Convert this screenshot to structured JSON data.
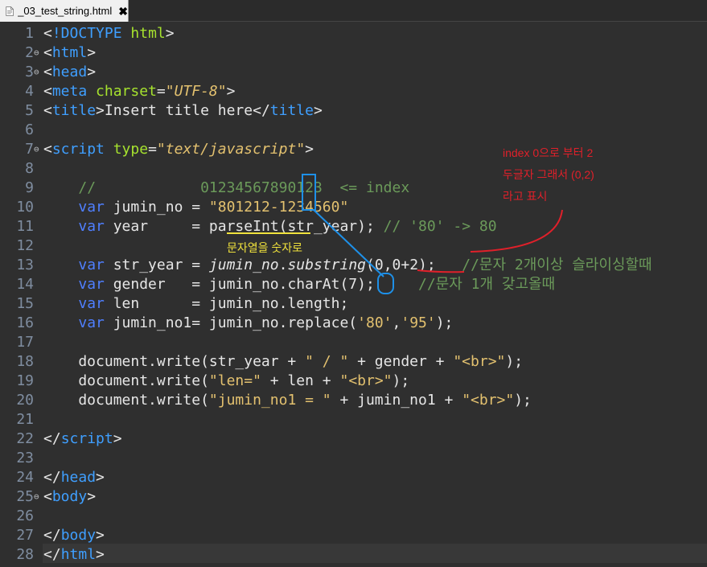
{
  "tab": {
    "title": "_03_test_string.html",
    "close": "✖"
  },
  "editor": {
    "lines": [
      {
        "n": "1",
        "fold": ""
      },
      {
        "n": "2",
        "fold": "⊖"
      },
      {
        "n": "3",
        "fold": "⊖"
      },
      {
        "n": "4",
        "fold": ""
      },
      {
        "n": "5",
        "fold": ""
      },
      {
        "n": "6",
        "fold": ""
      },
      {
        "n": "7",
        "fold": "⊖"
      },
      {
        "n": "8",
        "fold": ""
      },
      {
        "n": "9",
        "fold": ""
      },
      {
        "n": "10",
        "fold": ""
      },
      {
        "n": "11",
        "fold": ""
      },
      {
        "n": "12",
        "fold": ""
      },
      {
        "n": "13",
        "fold": ""
      },
      {
        "n": "14",
        "fold": ""
      },
      {
        "n": "15",
        "fold": ""
      },
      {
        "n": "16",
        "fold": ""
      },
      {
        "n": "17",
        "fold": ""
      },
      {
        "n": "18",
        "fold": ""
      },
      {
        "n": "19",
        "fold": ""
      },
      {
        "n": "20",
        "fold": ""
      },
      {
        "n": "21",
        "fold": ""
      },
      {
        "n": "22",
        "fold": ""
      },
      {
        "n": "23",
        "fold": ""
      },
      {
        "n": "24",
        "fold": ""
      },
      {
        "n": "25",
        "fold": "⊖"
      },
      {
        "n": "26",
        "fold": ""
      },
      {
        "n": "27",
        "fold": ""
      },
      {
        "n": "28",
        "fold": ""
      }
    ],
    "code": [
      [
        [
          "p",
          "<"
        ],
        [
          "tg",
          "!DOCTYPE"
        ],
        [
          "tx",
          " "
        ],
        [
          "at",
          "html"
        ],
        [
          "p",
          ">"
        ]
      ],
      [
        [
          "p",
          "<"
        ],
        [
          "tg",
          "html"
        ],
        [
          "p",
          ">"
        ]
      ],
      [
        [
          "p",
          "<"
        ],
        [
          "tg",
          "head"
        ],
        [
          "p",
          ">"
        ]
      ],
      [
        [
          "p",
          "<"
        ],
        [
          "tg",
          "meta"
        ],
        [
          "tx",
          " "
        ],
        [
          "at",
          "charset"
        ],
        [
          "p",
          "="
        ],
        [
          "sti",
          "\"UTF-8\""
        ],
        [
          "p",
          ">"
        ]
      ],
      [
        [
          "p",
          "<"
        ],
        [
          "tg",
          "title"
        ],
        [
          "p",
          ">"
        ],
        [
          "tx",
          "Insert title here"
        ],
        [
          "p",
          "</"
        ],
        [
          "tg",
          "title"
        ],
        [
          "p",
          ">"
        ]
      ],
      [],
      [
        [
          "p",
          "<"
        ],
        [
          "tg",
          "script"
        ],
        [
          "tx",
          " "
        ],
        [
          "at",
          "type"
        ],
        [
          "p",
          "="
        ],
        [
          "sti",
          "\"text/javascript\""
        ],
        [
          "p",
          ">"
        ]
      ],
      [],
      [
        [
          "tx",
          "    "
        ],
        [
          "cm",
          "//            01234567890123  <= index"
        ]
      ],
      [
        [
          "tx",
          "    "
        ],
        [
          "kw",
          "var"
        ],
        [
          "tx",
          " jumin_no = "
        ],
        [
          "st",
          "\"801212-1234560\""
        ]
      ],
      [
        [
          "tx",
          "    "
        ],
        [
          "kw",
          "var"
        ],
        [
          "tx",
          " year     = parseInt(str_year); "
        ],
        [
          "cm",
          "// '80' -> 80"
        ]
      ],
      [],
      [
        [
          "tx",
          "    "
        ],
        [
          "kw",
          "var"
        ],
        [
          "tx",
          " str_year = "
        ],
        [
          "iv",
          "jumin_no"
        ],
        [
          "tx",
          "."
        ],
        [
          "iv",
          "substring"
        ],
        [
          "tx",
          "(0,0+2);   "
        ],
        [
          "cm",
          "//문자 2개이상 슬라이싱할때"
        ]
      ],
      [
        [
          "tx",
          "    "
        ],
        [
          "kw",
          "var"
        ],
        [
          "tx",
          " gender   = jumin_no.charAt(7);     "
        ],
        [
          "cm",
          "//문자 1개 갖고올때"
        ]
      ],
      [
        [
          "tx",
          "    "
        ],
        [
          "kw",
          "var"
        ],
        [
          "tx",
          " len      = jumin_no.length;"
        ]
      ],
      [
        [
          "tx",
          "    "
        ],
        [
          "kw",
          "var"
        ],
        [
          "tx",
          " jumin_no1= jumin_no.replace("
        ],
        [
          "st",
          "'80'"
        ],
        [
          "tx",
          ","
        ],
        [
          "st",
          "'95'"
        ],
        [
          "tx",
          ");"
        ]
      ],
      [],
      [
        [
          "tx",
          "    document.write(str_year + "
        ],
        [
          "st",
          "\" / \""
        ],
        [
          "tx",
          " + gender + "
        ],
        [
          "st",
          "\"<br>\""
        ],
        [
          "tx",
          ");"
        ]
      ],
      [
        [
          "tx",
          "    document.write("
        ],
        [
          "st",
          "\"len=\""
        ],
        [
          "tx",
          " + len + "
        ],
        [
          "st",
          "\"<br>\""
        ],
        [
          "tx",
          ");"
        ]
      ],
      [
        [
          "tx",
          "    document.write("
        ],
        [
          "st",
          "\"jumin_no1 = \""
        ],
        [
          "tx",
          " + jumin_no1 + "
        ],
        [
          "st",
          "\"<br>\""
        ],
        [
          "tx",
          ");"
        ]
      ],
      [],
      [
        [
          "p",
          "</"
        ],
        [
          "tg",
          "script"
        ],
        [
          "p",
          ">"
        ]
      ],
      [],
      [
        [
          "p",
          "</"
        ],
        [
          "tg",
          "head"
        ],
        [
          "p",
          ">"
        ]
      ],
      [
        [
          "p",
          "<"
        ],
        [
          "tg",
          "body"
        ],
        [
          "p",
          ">"
        ]
      ],
      [],
      [
        [
          "p",
          "</"
        ],
        [
          "tg",
          "body"
        ],
        [
          "p",
          ">"
        ]
      ],
      [
        [
          "p",
          "</"
        ],
        [
          "tg",
          "html"
        ],
        [
          "p",
          ">"
        ]
      ]
    ]
  },
  "annotations": {
    "red_note_1": "index 0으로 부터 2",
    "red_note_2": "두글자 그래서 (0,2)",
    "red_note_3": "라고 표시",
    "yellow_note": "문자열을 숫자로"
  },
  "colors": {
    "red": "#e0202a",
    "yellow": "#f0e23c",
    "blue": "#1e90e8"
  }
}
